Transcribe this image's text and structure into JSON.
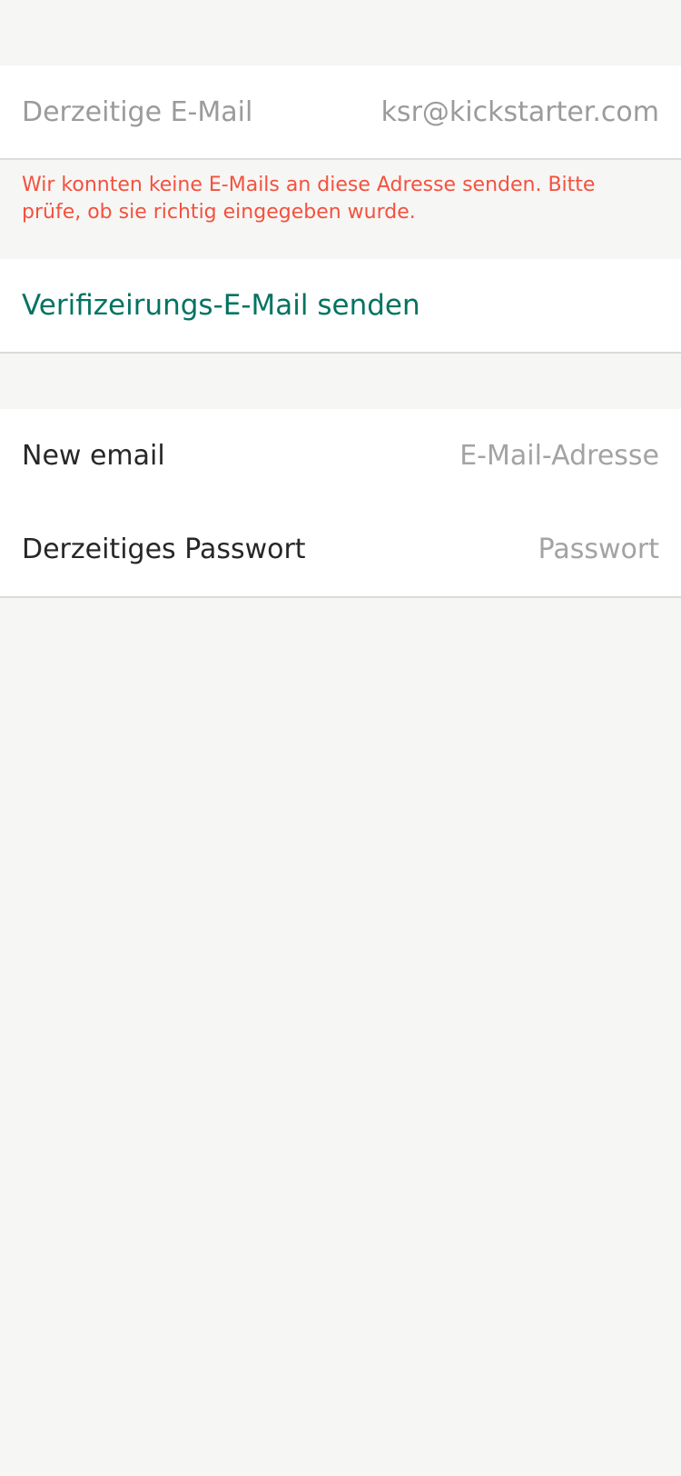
{
  "current_email": {
    "label": "Derzeitige E-Mail",
    "value": "ksr@kickstarter.com"
  },
  "error_message": "Wir konnten keine E-Mails an diese Adresse senden. Bitte prüfe, ob sie richtig eingegeben wurde.",
  "verification": {
    "label": "Verifizeirungs-E-Mail senden"
  },
  "new_email": {
    "label": "New email",
    "placeholder": "E-Mail-Adresse"
  },
  "current_password": {
    "label": "Derzeitiges Passwort",
    "placeholder": "Passwort"
  },
  "colors": {
    "background": "#f6f6f5",
    "error": "#f4513d",
    "link": "#037362",
    "muted_text": "#9b9b9b"
  }
}
